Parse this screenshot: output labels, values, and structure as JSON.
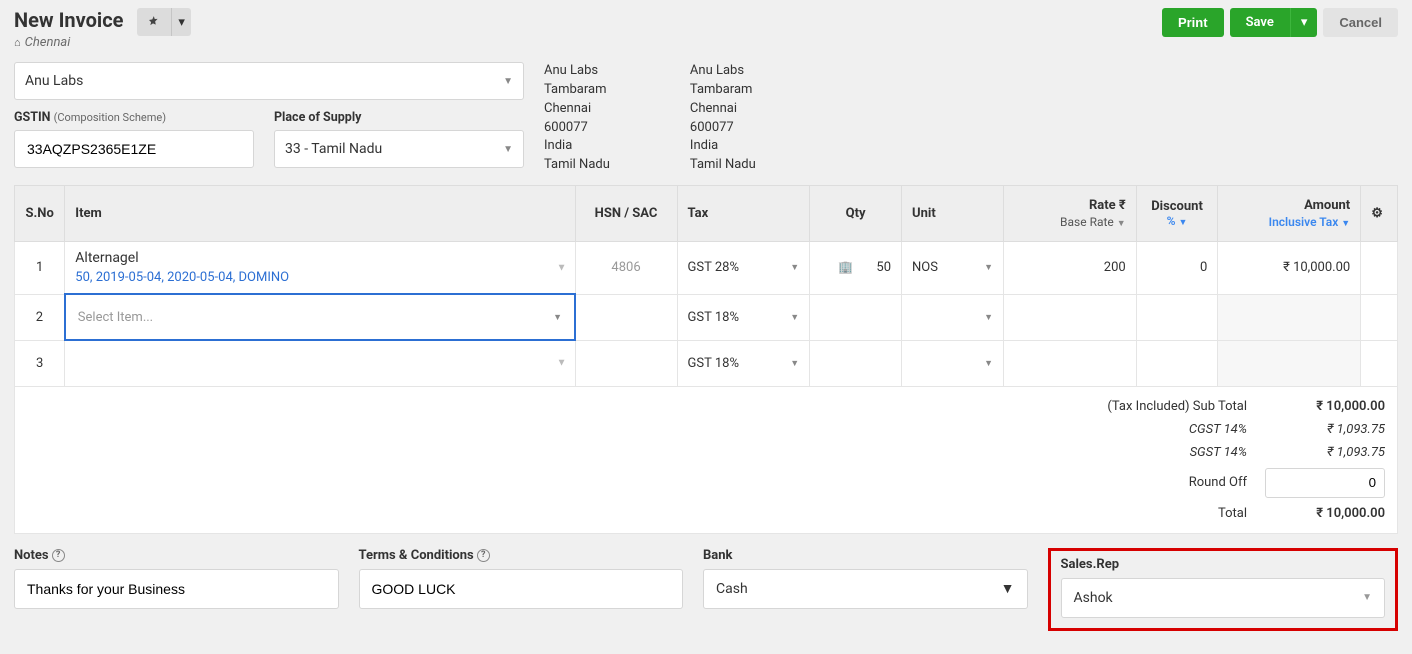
{
  "header": {
    "title": "New Invoice",
    "location": "Chennai",
    "print": "Print",
    "save": "Save",
    "cancel": "Cancel"
  },
  "customer": {
    "name": "Anu Labs"
  },
  "gstin": {
    "label": "GSTIN",
    "sub": "(Composition Scheme)",
    "value": "33AQZPS2365E1ZE"
  },
  "pos": {
    "label": "Place of Supply",
    "value": "33 - Tamil Nadu"
  },
  "addr1": {
    "name": "Anu Labs",
    "area": "Tambaram",
    "city": "Chennai",
    "pin": "600077",
    "country": "India",
    "state": "Tamil Nadu"
  },
  "addr2": {
    "name": "Anu Labs",
    "area": "Tambaram",
    "city": "Chennai",
    "pin": "600077",
    "country": "India",
    "state": "Tamil Nadu"
  },
  "cols": {
    "sno": "S.No",
    "item": "Item",
    "hsn": "HSN / SAC",
    "tax": "Tax",
    "qty": "Qty",
    "unit": "Unit",
    "rate": "Rate ₹",
    "baserate": "Base Rate",
    "disc": "Discount",
    "disc_pct": "%",
    "amt": "Amount",
    "amt_sub": "Inclusive Tax"
  },
  "rows": [
    {
      "sno": "1",
      "item": "Alternagel",
      "meta": "50, 2019-05-04, 2020-05-04, DOMINO",
      "hsn": "4806",
      "tax": "GST 28%",
      "qty": "50",
      "unit": "NOS",
      "rate": "200",
      "disc": "0",
      "amt": "₹ 10,000.00"
    },
    {
      "sno": "2",
      "placeholder": "Select Item...",
      "tax": "GST 18%"
    },
    {
      "sno": "3",
      "tax": "GST 18%"
    }
  ],
  "totals": {
    "subtotal_lbl": "(Tax Included) Sub Total",
    "subtotal": "₹ 10,000.00",
    "cgst_lbl": "CGST 14%",
    "cgst": "₹ 1,093.75",
    "sgst_lbl": "SGST 14%",
    "sgst": "₹ 1,093.75",
    "roundoff_lbl": "Round Off",
    "roundoff": "0",
    "total_lbl": "Total",
    "total": "₹ 10,000.00"
  },
  "footer": {
    "notes_lbl": "Notes",
    "notes": "Thanks for your Business",
    "terms_lbl": "Terms & Conditions",
    "terms": "GOOD LUCK",
    "bank_lbl": "Bank",
    "bank": "Cash",
    "rep_lbl": "Sales.Rep",
    "rep": "Ashok"
  }
}
